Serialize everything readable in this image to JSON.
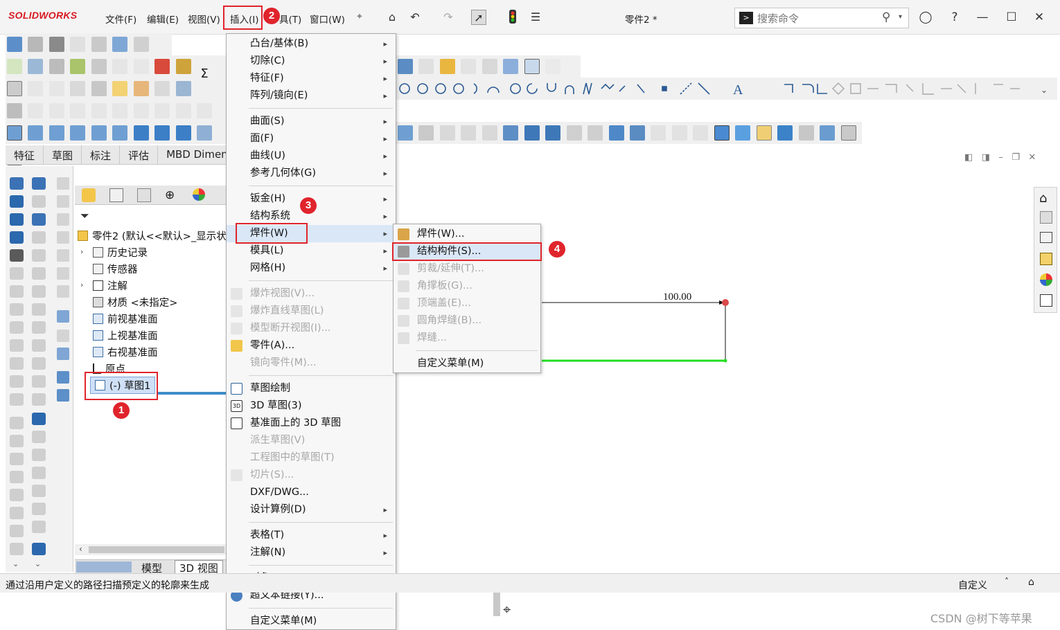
{
  "app": {
    "logo_text": "SOLIDWORKS",
    "document_title": "零件2 *"
  },
  "menubar": {
    "file": "文件(F)",
    "edit": "编辑(E)",
    "view": "视图(V)",
    "insert": "插入(I)",
    "tools_partial": "具(T)",
    "window": "窗口(W)"
  },
  "search": {
    "placeholder": "搜索命令"
  },
  "command_tabs": [
    "特征",
    "草图",
    "标注",
    "评估",
    "MBD Dimen"
  ],
  "feature_tree": {
    "part": "零件2  (默认<<默认>_显示状",
    "history": "历史记录",
    "sensors": "传感器",
    "annotations": "注解",
    "material": "材质 <未指定>",
    "front_plane": "前视基准面",
    "top_plane": "上视基准面",
    "right_plane": "右视基准面",
    "origin": "原点",
    "sketch": "(-) 草图1"
  },
  "bottom_tabs": {
    "model": "模型",
    "view3d": "3D 视图"
  },
  "status_bar": {
    "message": "通过沿用户定义的路径扫描预定义的轮廓来生成",
    "customize": "自定义"
  },
  "insert_menu": {
    "boss_base": "凸台/基体(B)",
    "cut": "切除(C)",
    "features": "特征(F)",
    "pattern_mirror": "阵列/镜向(E)",
    "surface": "曲面(S)",
    "face": "面(F)",
    "curve": "曲线(U)",
    "reference_geometry": "参考几何体(G)",
    "sheet_metal": "钣金(H)",
    "structure_system": "结构系统",
    "weldments": "焊件(W)",
    "molds": "模具(L)",
    "mesh": "网格(H)",
    "exploded_view": "爆炸视图(V)...",
    "explode_line_sketch": "爆炸直线草图(L)",
    "model_break_view": "模型断开视图(I)...",
    "part": "零件(A)...",
    "mirror_part": "镜向零件(M)...",
    "sketch": "草图绘制",
    "sketch3d": "3D 草图(3)",
    "sketch3d_on_plane": "基准面上的 3D 草图",
    "derived_sketch": "派生草图(V)",
    "sketch_in_drawing": "工程图中的草图(T)",
    "slice": "切片(S)...",
    "dxf_dwg": "DXF/DWG...",
    "design_study": "设计算例(D)",
    "tables": "表格(T)",
    "annotations": "注解(N)",
    "object": "对象(O)...",
    "hyperlink": "超文本链接(Y)...",
    "customize_menu": "自定义菜单(M)"
  },
  "weldments_menu": {
    "weldment": "焊件(W)...",
    "structural_member": "结构构件(S)...",
    "trim_extend": "剪裁/延伸(T)...",
    "gusset": "角撑板(G)...",
    "end_cap": "顶端盖(E)...",
    "fillet_bead": "圆角焊缝(B)...",
    "weld_bead": "焊缝...",
    "customize_menu": "自定义菜单(M)"
  },
  "annotations": {
    "badge_1": "1",
    "badge_2": "2",
    "badge_3": "3",
    "badge_4": "4"
  },
  "sketch": {
    "dimension": "100.00"
  },
  "watermark": "CSDN @树下等苹果",
  "colors": {
    "accent_red": "#e0242c",
    "sketch_green": "#22dd22",
    "selection_blue": "#cfe0f6"
  }
}
